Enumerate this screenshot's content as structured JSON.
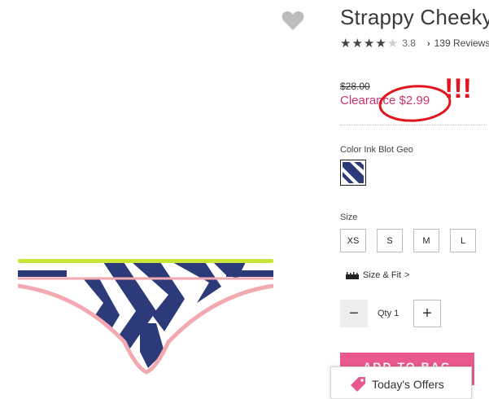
{
  "product": {
    "title": "Strappy Cheeky",
    "rating_value": "3.8",
    "rating": 3.8,
    "reviews_text": "139 Reviews",
    "original_price": "$28.00",
    "clearance_price": "Clearance $2.99",
    "color_label": "Color Ink Blot Geo",
    "size_label": "Size",
    "sizes": [
      "XS",
      "S",
      "M",
      "L"
    ],
    "size_fit_label": "Size & Fit",
    "size_fit_chevron": ">",
    "qty_label": "Qty 1",
    "minus_symbol": "−",
    "plus_symbol": "+",
    "add_to_bag": "ADD TO BAG"
  },
  "offers": {
    "label": "Today's Offers"
  },
  "annotation": {
    "text": "!!!",
    "color": "#e0161e"
  },
  "colors": {
    "accent_pink": "#c8336e",
    "button_pink": "#e9598d",
    "navy": "#2c3a7a",
    "lime": "#c9e53a",
    "trim_pink": "#f2a9b0"
  },
  "icons": {
    "wishlist": "heart-icon",
    "review_chevron": "chevron-right-icon",
    "size_fit": "ruler-icon",
    "offers": "tag-icon"
  }
}
